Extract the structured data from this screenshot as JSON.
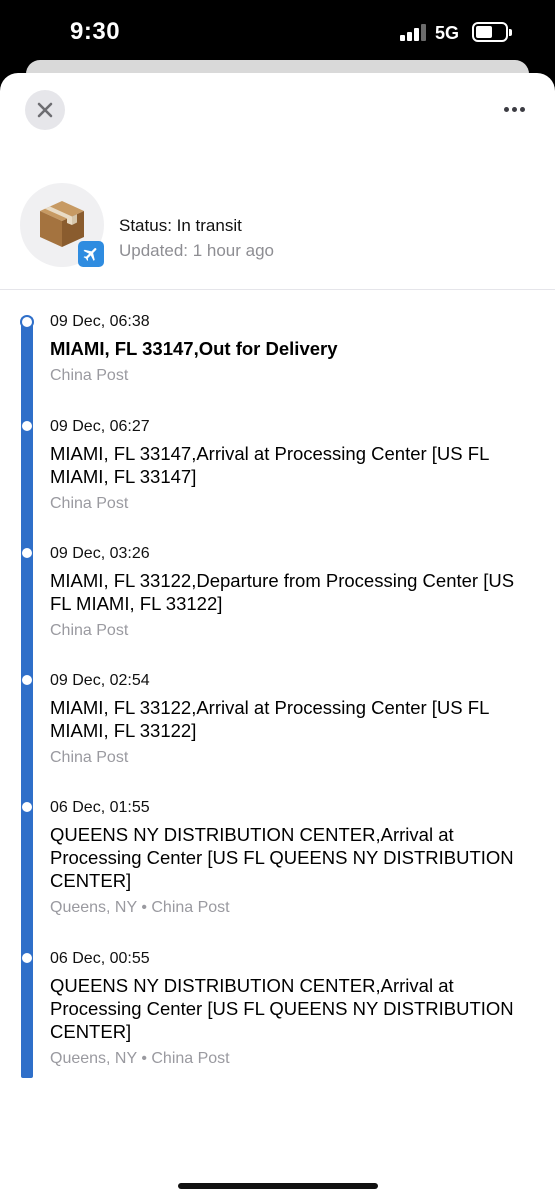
{
  "status_bar": {
    "time": "9:30",
    "network": "5G",
    "network_icon": "5g-uc-icon"
  },
  "header": {
    "close_icon": "close-icon",
    "more_icon": "more-icon"
  },
  "package": {
    "icon": "package-box-icon",
    "badge_icon": "airplane-icon",
    "badge_color": "#2f8ce0",
    "status": "Status: In transit",
    "updated": "Updated: 1 hour ago"
  },
  "timeline": {
    "accent_color": "#2f6fc9",
    "events": [
      {
        "date": "09 Dec, 06:38",
        "title": "MIAMI, FL 33147,Out for Delivery",
        "source": "China Post"
      },
      {
        "date": "09 Dec, 06:27",
        "title": "MIAMI, FL 33147,Arrival at Processing Center [US FL MIAMI, FL 33147]",
        "source": "China Post"
      },
      {
        "date": "09 Dec, 03:26",
        "title": "MIAMI, FL 33122,Departure from Processing Center [US FL MIAMI, FL 33122]",
        "source": "China Post"
      },
      {
        "date": "09 Dec, 02:54",
        "title": "MIAMI, FL 33122,Arrival at Processing Center [US FL MIAMI, FL 33122]",
        "source": "China Post"
      },
      {
        "date": "06 Dec, 01:55",
        "title": "QUEENS NY DISTRIBUTION CENTER,Arrival at Processing Center [US FL QUEENS NY DISTRIBUTION CENTER]",
        "source": "Queens, NY • China Post"
      },
      {
        "date": "06 Dec, 00:55",
        "title": "QUEENS NY DISTRIBUTION CENTER,Arrival at Processing Center [US FL QUEENS NY DISTRIBUTION CENTER]",
        "source": "Queens, NY • China Post"
      }
    ]
  }
}
